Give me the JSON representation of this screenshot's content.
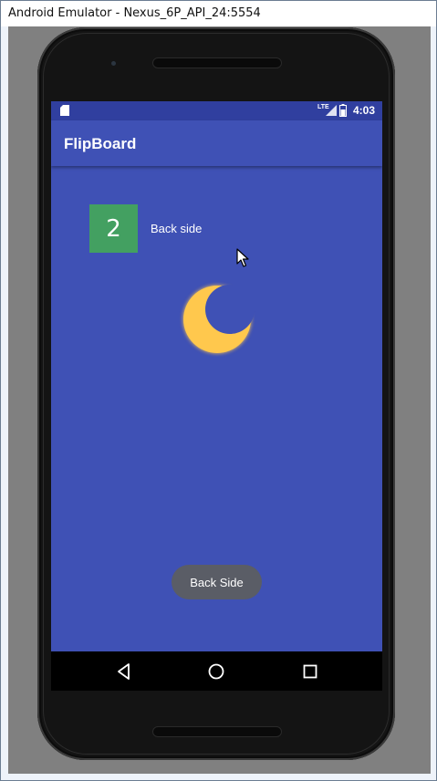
{
  "window": {
    "title": "Android Emulator - Nexus_6P_API_24:5554"
  },
  "statusbar": {
    "network": "LTE",
    "time": "4:03"
  },
  "app": {
    "title": "FlipBoard"
  },
  "card": {
    "number": "2",
    "label": "Back side"
  },
  "toast": {
    "text": "Back Side"
  },
  "colors": {
    "primary": "#3f51b5",
    "primary_dark": "#303f9f",
    "card": "#43a061",
    "moon": "#ffc84d",
    "toast": "#5a5d66"
  },
  "icons": [
    "sd-card-icon",
    "signal-icon",
    "battery-icon",
    "moon-icon",
    "back-icon",
    "home-icon",
    "recents-icon",
    "cursor-icon"
  ]
}
